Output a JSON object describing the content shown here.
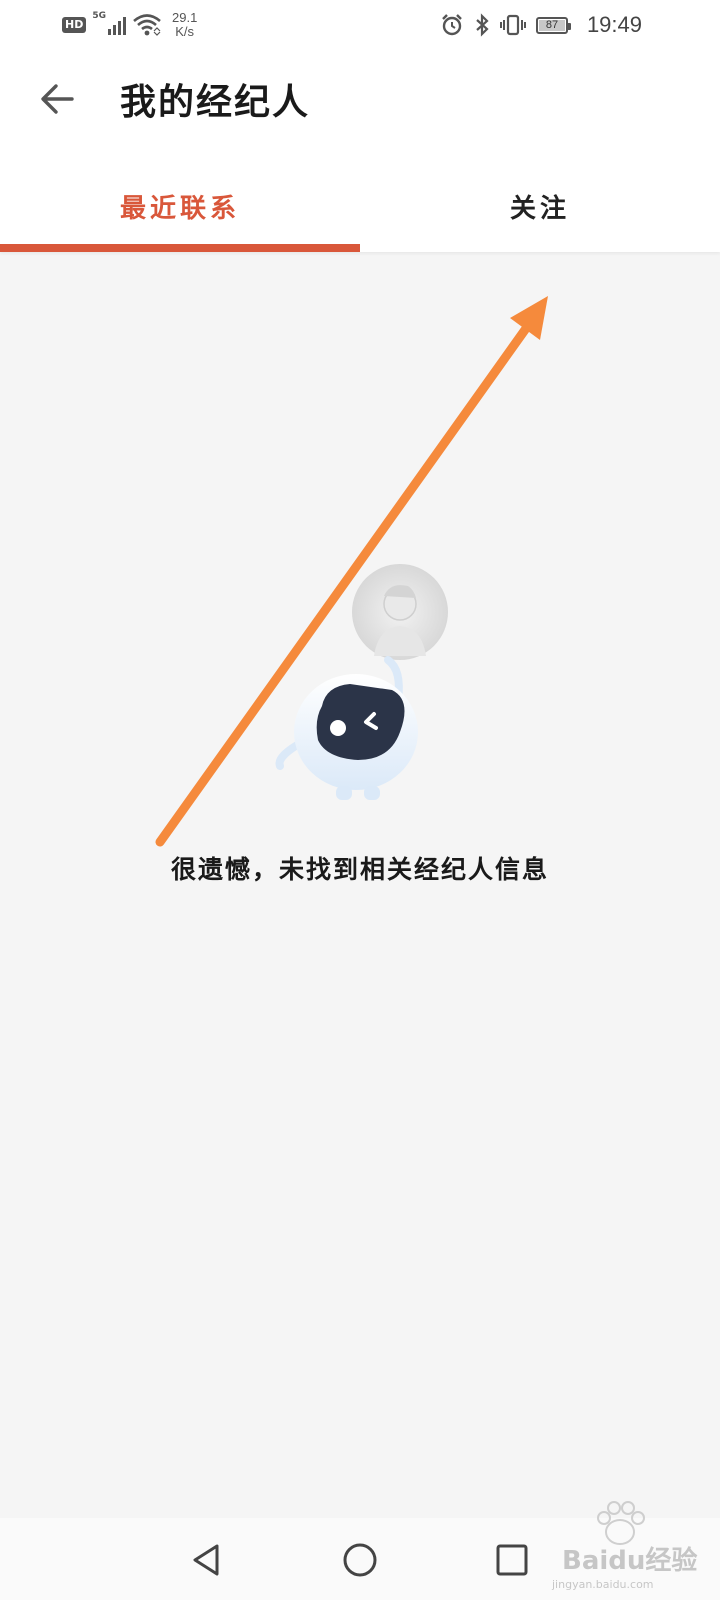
{
  "status_bar": {
    "hd": "HD",
    "network": "5G",
    "speed_value": "29.1",
    "speed_unit": "K/s",
    "battery": "87",
    "time": "19:49",
    "icons": [
      "signal-icon",
      "wifi-icon",
      "alarm-icon",
      "bluetooth-icon",
      "vibrate-icon",
      "battery-icon"
    ]
  },
  "header": {
    "title": "我的经纪人",
    "back_icon": "back-arrow-icon"
  },
  "tabs": [
    {
      "label": "最近联系",
      "active": true
    },
    {
      "label": "关注",
      "active": false
    }
  ],
  "empty_state": {
    "message": "很遗憾，未找到相关经纪人信息",
    "illustration": "robot-with-avatar"
  },
  "nav_bar": {
    "icons": [
      "back-triangle-icon",
      "home-circle-icon",
      "recents-square-icon"
    ]
  },
  "watermark": {
    "brand": "Baidu经验",
    "url": "jingyan.baidu.com"
  },
  "colors": {
    "accent": "#d9573a",
    "annotation_arrow": "#f58a3c",
    "background": "#f5f5f5"
  }
}
